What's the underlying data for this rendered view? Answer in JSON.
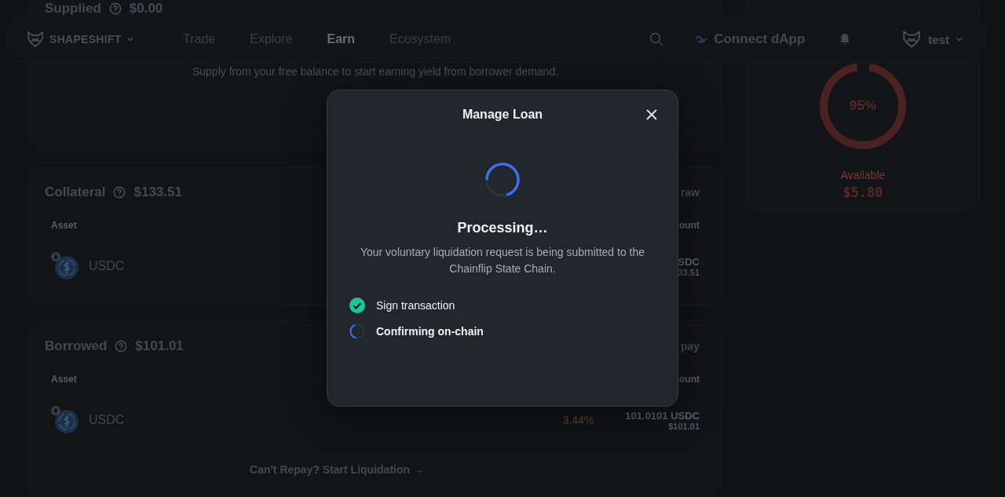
{
  "nav": {
    "brand": "SHAPESHIFT",
    "links": [
      {
        "label": "Trade",
        "selected": false
      },
      {
        "label": "Explore",
        "selected": false
      },
      {
        "label": "Earn",
        "selected": true
      },
      {
        "label": "Ecosystem",
        "selected": false
      }
    ],
    "connect": "Connect dApp",
    "account": "test"
  },
  "supply_card": {
    "title": "Supplied",
    "value": "$0.00",
    "hint": "Supply from your free balance to start earning yield from borrower demand."
  },
  "collateral": {
    "title": "Collateral",
    "value": "$133.51",
    "action": "raw",
    "column_1": "Asset",
    "column_2": "ount",
    "rows": [
      {
        "asset": "USDC",
        "amount": "SDC",
        "usd": "33.51"
      }
    ]
  },
  "borrowed": {
    "title": "Borrowed",
    "value": "$101.01",
    "action": "pay",
    "column_1": "Asset",
    "column_2": "ount",
    "rows": [
      {
        "asset": "USDC",
        "rate": "3.44%",
        "amount": "101.0101 USDC",
        "usd": "$101.01"
      }
    ],
    "link": "Can't Repay? Start Liquidation →"
  },
  "health": {
    "percent": "95%",
    "level": 0.95,
    "label": "Available",
    "value": "$5.80"
  },
  "modal": {
    "title": "Manage Loan",
    "heading": "Processing…",
    "message": "Your voluntary liquidation request is being submitted to the Chainflip State Chain.",
    "steps": [
      {
        "label": "Sign transaction",
        "completed": true
      },
      {
        "label": "Confirming on-chain",
        "completed": false
      }
    ]
  }
}
